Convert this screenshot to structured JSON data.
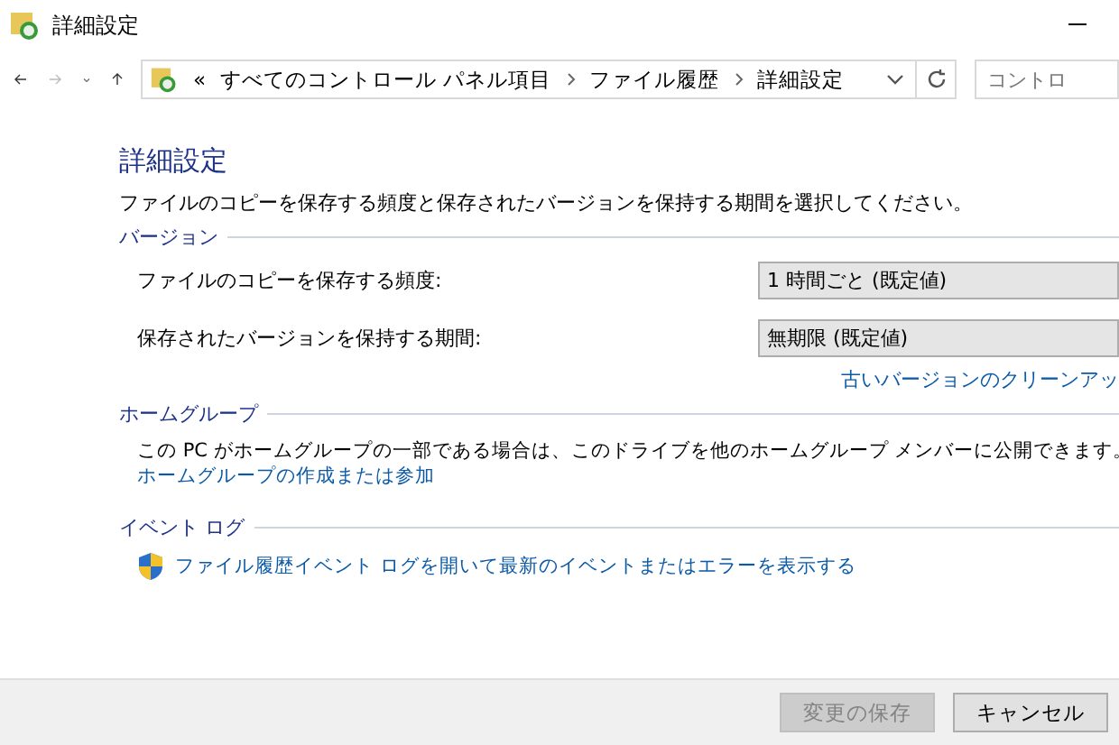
{
  "window": {
    "title": "詳細設定"
  },
  "nav": {
    "back_disabled": false,
    "forward_disabled": true,
    "breadcrumb_prefix": "«",
    "breadcrumb": [
      "すべてのコントロール パネル項目",
      "ファイル履歴",
      "詳細設定"
    ],
    "search": {
      "placeholder": "コントロ"
    }
  },
  "heading": "詳細設定",
  "description": "ファイルのコピーを保存する頻度と保存されたバージョンを保持する期間を選択してください。",
  "version_section": {
    "label": "バージョン",
    "settings": [
      {
        "label": "ファイルのコピーを保存する頻度:",
        "value": "1 時間ごと (既定値)"
      },
      {
        "label": "保存されたバージョンを保持する期間:",
        "value": "無期限 (既定値)"
      }
    ],
    "link": "古いバージョンのクリーンアッ"
  },
  "homegroup_section": {
    "label": "ホームグループ",
    "text": "この PC がホームグループの一部である場合は、このドライブを他のホームグループ メンバーに公開できます。",
    "link": "ホームグループの作成または参加"
  },
  "eventlog_section": {
    "label": "イベント ログ",
    "link": "ファイル履歴イベント ログを開いて最新のイベントまたはエラーを表示する"
  },
  "buttons": [
    {
      "label": "変更の保存",
      "disabled": true
    },
    {
      "label": "キャンセル",
      "disabled": false
    }
  ]
}
